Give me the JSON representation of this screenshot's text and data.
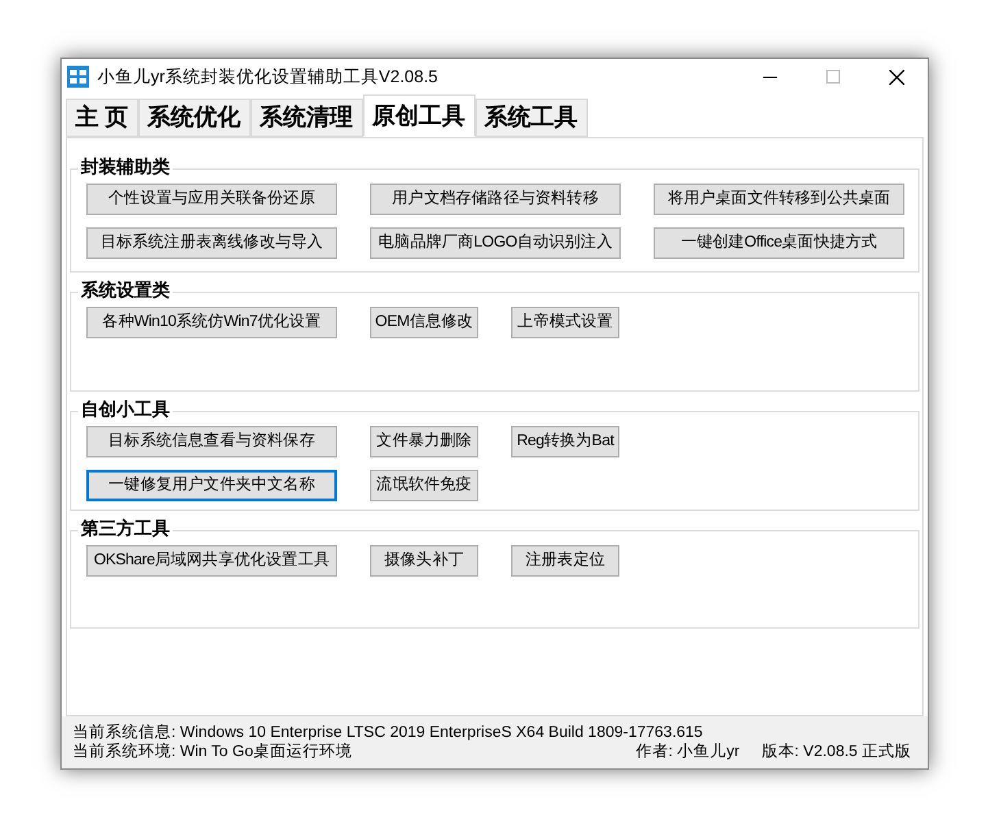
{
  "window": {
    "title": "小鱼儿yr系统封装优化设置辅助工具V2.08.5"
  },
  "tabs": [
    {
      "label": "主 页",
      "selected": false
    },
    {
      "label": "系统优化",
      "selected": false
    },
    {
      "label": "系统清理",
      "selected": false
    },
    {
      "label": "原创工具",
      "selected": true
    },
    {
      "label": "系统工具",
      "selected": false
    }
  ],
  "groups": [
    {
      "title": "封装辅助类",
      "buttons": [
        {
          "label": "个性设置与应用关联备份还原",
          "focused": false
        },
        {
          "label": "用户文档存储路径与资料转移",
          "focused": false
        },
        {
          "label": "将用户桌面文件转移到公共桌面",
          "focused": false
        },
        {
          "label": "目标系统注册表离线修改与导入",
          "focused": false
        },
        {
          "label": "电脑品牌厂商LOGO自动识别注入",
          "focused": false
        },
        {
          "label": "一键创建Office桌面快捷方式",
          "focused": false
        }
      ]
    },
    {
      "title": "系统设置类",
      "buttons": [
        {
          "label": "各种Win10系统仿Win7优化设置",
          "focused": false
        },
        {
          "label": "OEM信息修改",
          "focused": false
        },
        {
          "label": "上帝模式设置",
          "focused": false
        }
      ]
    },
    {
      "title": "自创小工具",
      "buttons": [
        {
          "label": "目标系统信息查看与资料保存",
          "focused": false
        },
        {
          "label": "文件暴力删除",
          "focused": false
        },
        {
          "label": "Reg转换为Bat",
          "focused": false
        },
        {
          "label": "一键修复用户文件夹中文名称",
          "focused": true
        },
        {
          "label": "流氓软件免疫",
          "focused": false
        }
      ]
    },
    {
      "title": "第三方工具",
      "buttons": [
        {
          "label": "OKShare局域网共享优化设置工具",
          "focused": false
        },
        {
          "label": "摄像头补丁",
          "focused": false
        },
        {
          "label": "注册表定位",
          "focused": false
        }
      ]
    }
  ],
  "status_bar": {
    "system_info": "当前系统信息: Windows 10 Enterprise LTSC 2019 EnterpriseS X64 Build 1809-17763.615",
    "environment": "当前系统环境: Win To Go桌面运行环境",
    "author": "作者: 小鱼儿yr",
    "version": "版本: V2.08.5 正式版"
  }
}
